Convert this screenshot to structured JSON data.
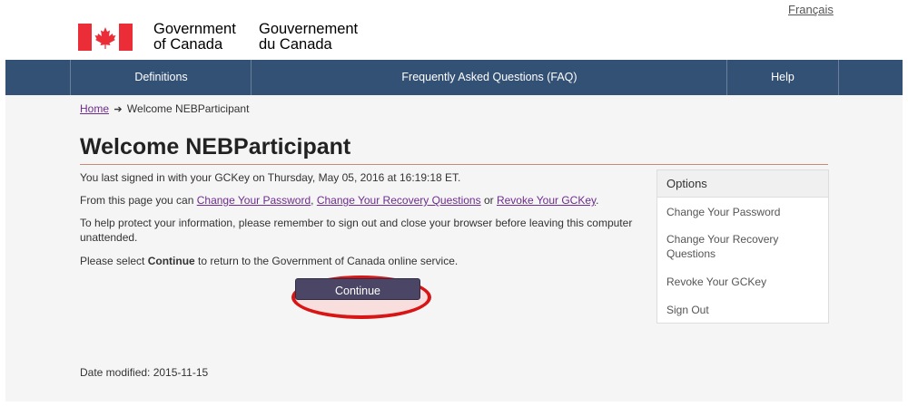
{
  "header": {
    "language_link": "Français",
    "signature_en_line1": "Government",
    "signature_en_line2": "of Canada",
    "signature_fr_line1": "Gouvernement",
    "signature_fr_line2": "du Canada"
  },
  "nav": {
    "items": [
      {
        "label": "Definitions"
      },
      {
        "label": "Frequently Asked Questions (FAQ)"
      },
      {
        "label": "Help"
      }
    ]
  },
  "breadcrumb": {
    "home": "Home",
    "current": "Welcome NEBParticipant"
  },
  "main": {
    "title": "Welcome NEBParticipant",
    "last_signed": "You last signed in with your GCKey on Thursday, May 05, 2016 at 16:19:18 ET.",
    "from_page_prefix": "From this page you can ",
    "link_change_password": "Change Your Password",
    "comma": ", ",
    "link_change_questions": "Change Your Recovery Questions",
    "or": " or ",
    "link_revoke": "Revoke Your GCKey",
    "period": ".",
    "protect_text": "To help protect your information, please remember to sign out and close your browser before leaving this computer unattended.",
    "select_prefix": "Please select ",
    "select_bold": "Continue",
    "select_suffix": " to return to the Government of Canada online service.",
    "continue_button": "Continue"
  },
  "options": {
    "heading": "Options",
    "items": [
      {
        "label": "Change Your Password"
      },
      {
        "label": "Change Your Recovery Questions"
      },
      {
        "label": "Revoke Your GCKey"
      },
      {
        "label": "Sign Out"
      }
    ]
  },
  "footer": {
    "date_modified": "Date modified: 2015-11-15"
  },
  "colors": {
    "nav_bg": "#335075",
    "flag_red": "#eb2d37",
    "highlight_oval": "#d81414",
    "continue_bg": "#4b4666"
  }
}
